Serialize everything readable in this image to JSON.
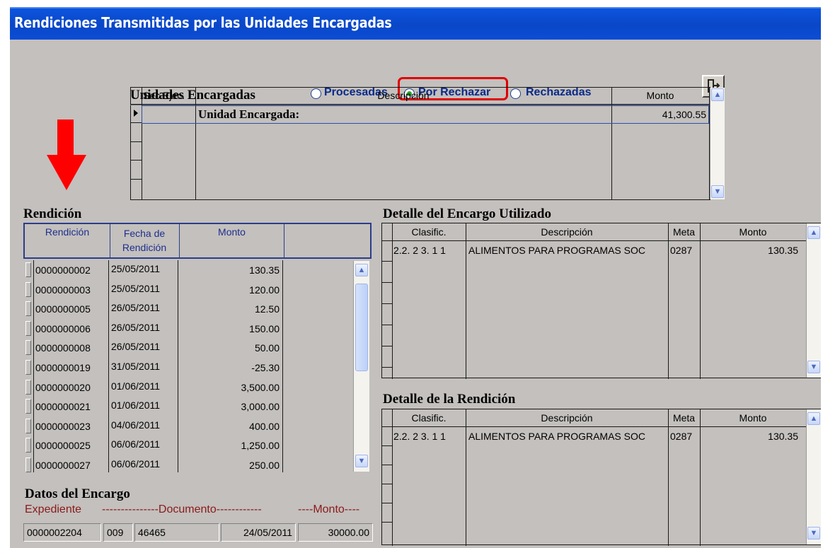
{
  "window": {
    "title": "Rendiciones Transmitidas por las Unidades Encargadas"
  },
  "unidades": {
    "heading": "Unidades Encargadas",
    "filters": [
      {
        "label": "Procesadas",
        "selected": false
      },
      {
        "label": "Por Rechazar",
        "selected": true
      },
      {
        "label": "Rechazadas",
        "selected": false
      }
    ],
    "columns": [
      "Sec.Ejec.",
      "Descripción",
      "Monto"
    ],
    "rows": [
      {
        "sec": "",
        "descripcion": "Unidad  Encargada:",
        "monto": "41,300.55"
      }
    ]
  },
  "rendicion": {
    "heading": "Rendición",
    "columns": [
      "Rendición",
      "Fecha de Rendición",
      "Monto"
    ],
    "rows": [
      {
        "rendicion": "0000000002",
        "fecha": "25/05/2011",
        "monto": "130.35"
      },
      {
        "rendicion": "0000000003",
        "fecha": "25/05/2011",
        "monto": "120.00"
      },
      {
        "rendicion": "0000000005",
        "fecha": "26/05/2011",
        "monto": "12.50"
      },
      {
        "rendicion": "0000000006",
        "fecha": "26/05/2011",
        "monto": "150.00"
      },
      {
        "rendicion": "0000000008",
        "fecha": "26/05/2011",
        "monto": "50.00"
      },
      {
        "rendicion": "0000000019",
        "fecha": "31/05/2011",
        "monto": "-25.30"
      },
      {
        "rendicion": "0000000020",
        "fecha": "01/06/2011",
        "monto": "3,500.00"
      },
      {
        "rendicion": "0000000021",
        "fecha": "01/06/2011",
        "monto": "3,000.00"
      },
      {
        "rendicion": "0000000023",
        "fecha": "04/06/2011",
        "monto": "400.00"
      },
      {
        "rendicion": "0000000025",
        "fecha": "06/06/2011",
        "monto": "1,250.00"
      },
      {
        "rendicion": "0000000027",
        "fecha": "06/06/2011",
        "monto": "250.00"
      }
    ]
  },
  "encargo_utilizado": {
    "heading": "Detalle del Encargo Utilizado",
    "columns": [
      "Clasific.",
      "Descripción",
      "Meta",
      "Monto"
    ],
    "rows": [
      {
        "clasific": "2.2. 2 3. 1 1",
        "descripcion": "ALIMENTOS PARA PROGRAMAS SOC",
        "meta": "0287",
        "monto": "130.35"
      }
    ]
  },
  "detalle_rendicion": {
    "heading": "Detalle de la Rendición",
    "columns": [
      "Clasific.",
      "Descripción",
      "Meta",
      "Monto"
    ],
    "rows": [
      {
        "clasific": "2.2. 2 3. 1 1",
        "descripcion": "ALIMENTOS PARA PROGRAMAS SOC",
        "meta": "0287",
        "monto": "130.35"
      }
    ]
  },
  "datos_encargo": {
    "heading": "Datos del Encargo",
    "label_expediente": "Expediente",
    "label_documento": "---------------Documento------------",
    "label_monto": "----Monto----",
    "expediente": "0000002204",
    "doc_tipo": "009",
    "doc_numero": "46465",
    "doc_fecha": "24/05/2011",
    "monto": "30000.00"
  },
  "colors": {
    "highlight_red": "#e00000",
    "titlebar": "#0a47c8",
    "panel": "#c3c0bd"
  }
}
